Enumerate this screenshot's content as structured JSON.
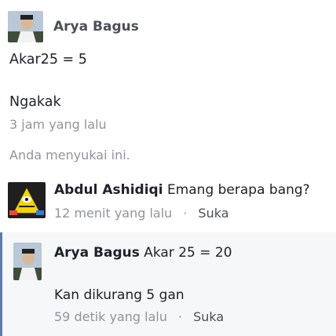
{
  "post": {
    "author": "Arya Bagus",
    "line1": "Akar25 = 5",
    "line2": "Ngakak",
    "time": "3 jam yang lalu",
    "likes_text": "Anda menyukai ini."
  },
  "comments": [
    {
      "author": "Abdul Ashidiqi",
      "text": "Emang berapa bang?",
      "time": "12 menit yang lalu",
      "separator": "·",
      "like_label": "Suka"
    },
    {
      "author": "Arya Bagus",
      "text": "Akar 25 = 20",
      "text2": "Kan dikurang 5 gan",
      "time": "59 detik yang lalu",
      "separator": "·",
      "like_label": "Suka"
    }
  ]
}
